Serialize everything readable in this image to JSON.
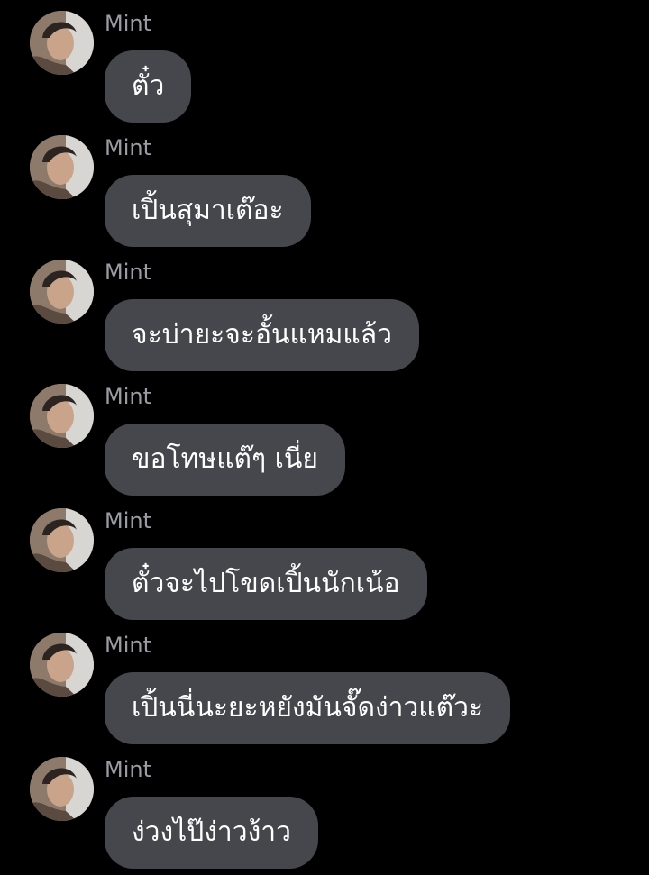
{
  "chat": {
    "messages": [
      {
        "sender": "Mint",
        "text": "ตั๋ว"
      },
      {
        "sender": "Mint",
        "text": "เปิ้นสุมาเต๊อะ"
      },
      {
        "sender": "Mint",
        "text": "จะบ่ายะจะอั้นแหมแล้ว"
      },
      {
        "sender": "Mint",
        "text": "ขอโทษแต๊ๆ เนี่ย"
      },
      {
        "sender": "Mint",
        "text": "ตั๋วจะไปโขดเปิ้นนักเน้อ"
      },
      {
        "sender": "Mint",
        "text": "เปิ้นนี่นะยะหยังมันจั๊ดง่าวแต๊วะ"
      },
      {
        "sender": "Mint",
        "text": "ง่วงไป๊ง่าวง้าว"
      }
    ]
  },
  "colors": {
    "background": "#000000",
    "bubble": "#45474c",
    "sender_name": "#9a9ca1",
    "message_text": "#ffffff"
  },
  "icons": {
    "avatar": "user-photo"
  }
}
